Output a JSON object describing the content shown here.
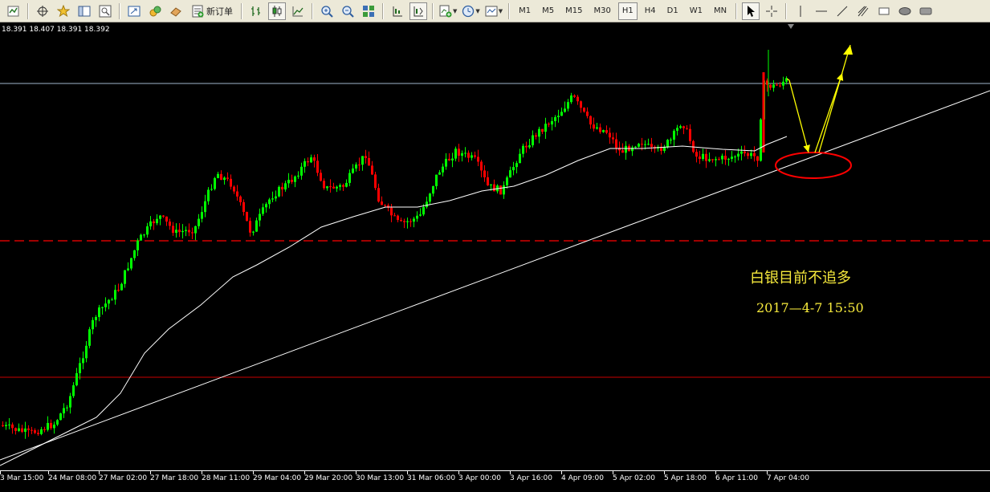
{
  "toolbar": {
    "new_order_label": "新订单",
    "timeframes": [
      "M1",
      "M5",
      "M15",
      "M30",
      "H1",
      "H4",
      "D1",
      "W1",
      "MN"
    ],
    "active_timeframe": "H1",
    "icons": [
      "new-chart-icon",
      "crosshair-move-icon",
      "favorites-icon",
      "navigator-icon",
      "terminal-icon",
      "fullscreen-icon",
      "experts-icon",
      "history-icon",
      "new-order-icon",
      "bar-chart-icon",
      "candlestick-icon",
      "line-chart-icon",
      "zoom-in-icon",
      "zoom-out-icon",
      "tile-windows-icon",
      "auto-scroll-icon",
      "chart-shift-icon",
      "indicators-icon",
      "periods-icon",
      "templates-icon",
      "cursor-icon",
      "crosshair-icon",
      "vertical-line-icon",
      "horizontal-line-icon",
      "trendline-icon",
      "fibonacci-icon",
      "text-icon",
      "ellipse-icon",
      "label-icon"
    ]
  },
  "chart": {
    "ohlc": "18.391 18.407 18.391 18.392",
    "annotation_title": "白银目前不追多",
    "annotation_time": "2017—4-7  15:50",
    "colors": {
      "background": "#000000",
      "bull": "#00ff00",
      "bear": "#ff0000",
      "moving_average": "#ffffff",
      "trendline": "#ffffff",
      "resistance_line": "#9fb6cd",
      "support_dashed": "#ff0000",
      "support_solid": "#c80000",
      "arrow": "#ffff00",
      "ellipse": "#ff0000",
      "annotation_text": "#f7ea3c"
    },
    "time_labels": [
      "3 Mar 15:00",
      "24 Mar 08:00",
      "27 Mar 02:00",
      "27 Mar 18:00",
      "28 Mar 11:00",
      "29 Mar 04:00",
      "29 Mar 20:00",
      "30 Mar 13:00",
      "31 Mar 06:00",
      "3 Apr 00:00",
      "3 Apr 16:00",
      "4 Apr 09:00",
      "5 Apr 02:00",
      "5 Apr 18:00",
      "6 Apr 11:00",
      "7 Apr 04:00"
    ]
  }
}
